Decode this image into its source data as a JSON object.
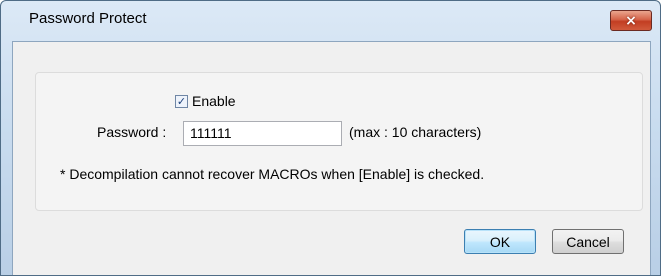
{
  "window": {
    "title": "Password Protect",
    "close_glyph": "×"
  },
  "form": {
    "enable": {
      "label": "Enable",
      "checked": true,
      "check_glyph": "✓"
    },
    "password": {
      "label": "Password :",
      "value": "111111",
      "hint": "(max : 10 characters)"
    },
    "note": "* Decompilation cannot recover MACROs when [Enable] is checked."
  },
  "buttons": {
    "ok_label": "OK",
    "cancel_label": "Cancel"
  },
  "icons": {
    "close": "close-icon",
    "check": "checkmark-icon"
  },
  "colors": {
    "close_button": "#c94a2e",
    "ok_border": "#3c7fb1"
  }
}
